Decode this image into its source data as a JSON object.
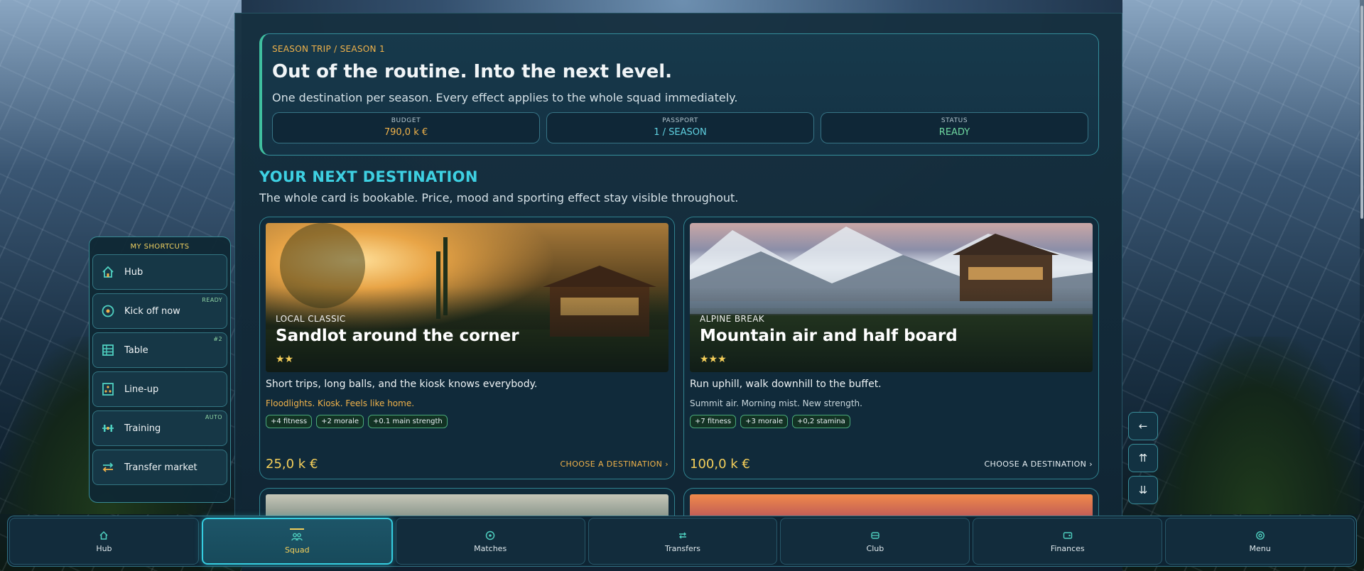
{
  "hero": {
    "breadcrumb": "SEASON TRIP  /  SEASON 1",
    "title": "Out of the routine. Into the next level.",
    "subtitle": "One destination per season. Every effect applies to the whole squad immediately.",
    "stats": [
      {
        "label": "BUDGET",
        "value": "790,0 k €"
      },
      {
        "label": "PASSPORT",
        "value": "1 / SEASON"
      },
      {
        "label": "STATUS",
        "value": "READY"
      }
    ]
  },
  "section": {
    "title": "YOUR NEXT DESTINATION",
    "subtitle": "The whole card is bookable. Price, mood and sporting effect stay visible throughout."
  },
  "cards": [
    {
      "tag": "LOCAL CLASSIC",
      "title": "Sandlot around the corner",
      "stars": "★★",
      "description": "Short trips, long balls, and the kiosk knows everybody.",
      "note": "Floodlights. Kiosk. Feels like home.",
      "chips": [
        "+4 fitness",
        "+2 morale",
        "+0.1 main strength"
      ],
      "price": "25,0 k €",
      "cta": "CHOOSE A DESTINATION  ›"
    },
    {
      "tag": "ALPINE BREAK",
      "title": "Mountain air and half board",
      "stars": "★★★",
      "description": "Run uphill, walk downhill to the buffet.",
      "note": "Summit air. Morning mist. New strength.",
      "chips": [
        "+7 fitness",
        "+3 morale",
        "+0,2 stamina"
      ],
      "price": "100,0 k €",
      "cta": "CHOOSE A DESTINATION  ›"
    }
  ],
  "shortcuts": {
    "title": "MY SHORTCUTS",
    "items": [
      {
        "label": "Hub",
        "badge": ""
      },
      {
        "label": "Kick off now",
        "badge": "READY"
      },
      {
        "label": "Table",
        "badge": "#2"
      },
      {
        "label": "Line-up",
        "badge": ""
      },
      {
        "label": "Training",
        "badge": "AUTO"
      },
      {
        "label": "Transfer market",
        "badge": ""
      }
    ]
  },
  "scroll_buttons": [
    "←",
    "⇈",
    "⇊"
  ],
  "nav": {
    "items": [
      "Hub",
      "Squad",
      "Matches",
      "Transfers",
      "Club",
      "Finances",
      "Menu"
    ],
    "active": "Squad"
  },
  "colors": {
    "accent": "#3ed0e2",
    "gold": "#f0b24a",
    "positive": "#6fd7a0"
  }
}
